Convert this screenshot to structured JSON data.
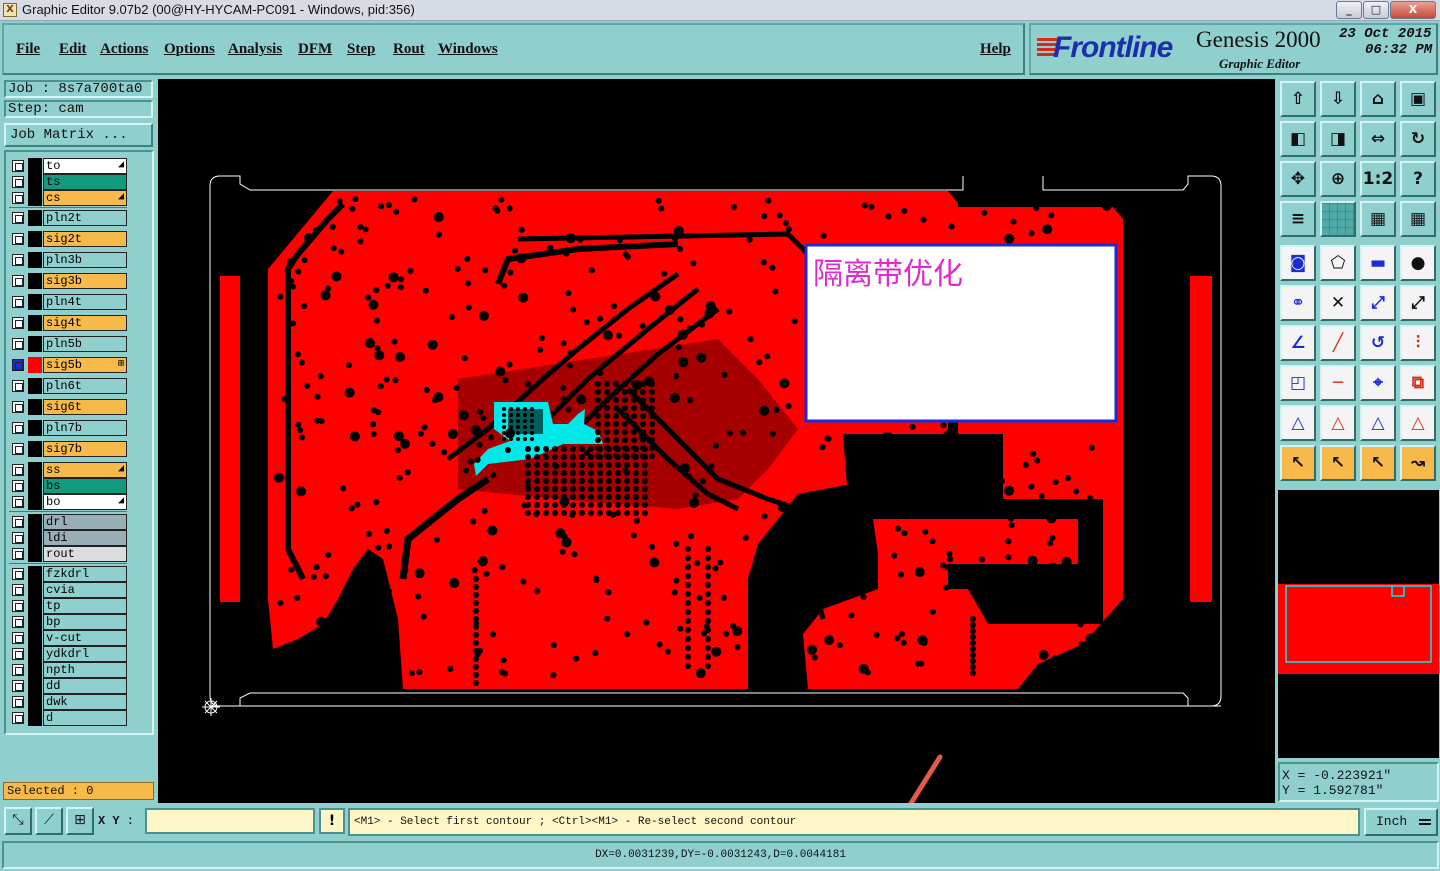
{
  "window": {
    "title": "Graphic Editor 9.07b2 (00@HY-HYCAM-PC091 - Windows, pid:356)",
    "app_icon": "x-app-icon",
    "controls": {
      "minimize": "_",
      "maximize": "□",
      "close": "X"
    }
  },
  "menu": [
    "File",
    "Edit",
    "Actions",
    "Options",
    "Analysis",
    "DFM",
    "Step",
    "Rout",
    "Windows"
  ],
  "help": "Help",
  "brand": {
    "logo": "Frontline",
    "product": "Genesis 2000",
    "subtitle": "Graphic Editor",
    "date": "23 Oct 2015",
    "time": "06:32 PM"
  },
  "job": {
    "job_text": "Job : 8s7a700ta0",
    "step_text": "Step: cam",
    "matrix_button": "Job Matrix ..."
  },
  "layers": [
    {
      "name": "to",
      "color": "#ffffff",
      "mark": "◢"
    },
    {
      "name": "ts",
      "color": "#129a7e",
      "mark": ""
    },
    {
      "name": "cs",
      "color": "#f6b94a",
      "mark": "◢"
    },
    {
      "name": "pln2t",
      "color": "#8fd0cf",
      "mark": ""
    },
    {
      "name": "sig2t",
      "color": "#f6b94a",
      "mark": ""
    },
    {
      "name": "pln3b",
      "color": "#8fd0cf",
      "mark": ""
    },
    {
      "name": "sig3b",
      "color": "#f6b94a",
      "mark": ""
    },
    {
      "name": "pln4t",
      "color": "#8fd0cf",
      "mark": ""
    },
    {
      "name": "sig4t",
      "color": "#f6b94a",
      "mark": ""
    },
    {
      "name": "pln5b",
      "color": "#8fd0cf",
      "mark": ""
    },
    {
      "name": "sig5b",
      "color": "#f6b94a",
      "mark": "⊞",
      "active": true
    },
    {
      "name": "pln6t",
      "color": "#8fd0cf",
      "mark": ""
    },
    {
      "name": "sig6t",
      "color": "#f6b94a",
      "mark": ""
    },
    {
      "name": "pln7b",
      "color": "#8fd0cf",
      "mark": ""
    },
    {
      "name": "sig7b",
      "color": "#f6b94a",
      "mark": ""
    },
    {
      "name": "ss",
      "color": "#f6b94a",
      "mark": "◢"
    },
    {
      "name": "bs",
      "color": "#129a7e",
      "mark": ""
    },
    {
      "name": "bo",
      "color": "#ffffff",
      "mark": "◢"
    },
    {
      "name": "drl",
      "color": "#9aaeb8",
      "mark": ""
    },
    {
      "name": "ldi",
      "color": "#9aaeb8",
      "mark": ""
    },
    {
      "name": "rout",
      "color": "#dcdcdc",
      "mark": ""
    },
    {
      "name": "fzkdrl",
      "color": "#8fd0cf",
      "mark": ""
    },
    {
      "name": "cvia",
      "color": "#8fd0cf",
      "mark": ""
    },
    {
      "name": "tp",
      "color": "#8fd0cf",
      "mark": ""
    },
    {
      "name": "bp",
      "color": "#8fd0cf",
      "mark": ""
    },
    {
      "name": "v-cut",
      "color": "#8fd0cf",
      "mark": ""
    },
    {
      "name": "ydkdrl",
      "color": "#8fd0cf",
      "mark": ""
    },
    {
      "name": "npth",
      "color": "#8fd0cf",
      "mark": ""
    },
    {
      "name": "dd",
      "color": "#8fd0cf",
      "mark": ""
    },
    {
      "name": "dwk",
      "color": "#8fd0cf",
      "mark": ""
    },
    {
      "name": "d",
      "color": "#8fd0cf",
      "mark": ""
    }
  ],
  "selected_text": "Selected : 0",
  "annotation_text": "隔离带优化",
  "coords": {
    "x_text": "X = -0.223921\"",
    "y_text": "Y = 1.592781\""
  },
  "bottom": {
    "xy_label": "X Y :",
    "xy_value": "",
    "excl": "!",
    "prompt": "<M1> - Select first contour ; <Ctrl><M1> - Re-select second contour",
    "unit": "Inch"
  },
  "status": "DX=0.0031239,DY=-0.0031243,D=0.0044181",
  "toolbar_icons": [
    "snap-up-icon",
    "snap-down-icon",
    "home-icon",
    "window-split-icon",
    "pan-left-icon",
    "pan-right-icon",
    "pan-both-icon",
    "redraw-icon",
    "fit-screen-icon",
    "zoom-fit-icon",
    "scale-1-2-icon",
    "help-query-icon",
    "graphic-control-icon",
    "grid-icon",
    "layer-display-icon",
    "layer-display-2-icon",
    "select-feature-icon",
    "select-polygon-icon",
    "ruler-icon",
    "pad-icon",
    "net-icon",
    "cross-icon",
    "connect-icon",
    "connect-2-icon",
    "angle-icon",
    "line-icon",
    "arc-icon",
    "text-f-icon",
    "snap-point-icon",
    "horizontal-line-icon",
    "measure-icon",
    "copy-icon",
    "triangle-1-icon",
    "triangle-2-icon",
    "triangle-3-icon",
    "triangle-4-icon",
    "pointer-icon",
    "pointer-box-icon",
    "pointer-circle-icon",
    "pointer-route-icon"
  ],
  "colors": {
    "copper": "#ff0000",
    "highlight": "#00e8e8",
    "annotation_border": "#1a2bd8",
    "annotation_text": "#e02ad0"
  }
}
